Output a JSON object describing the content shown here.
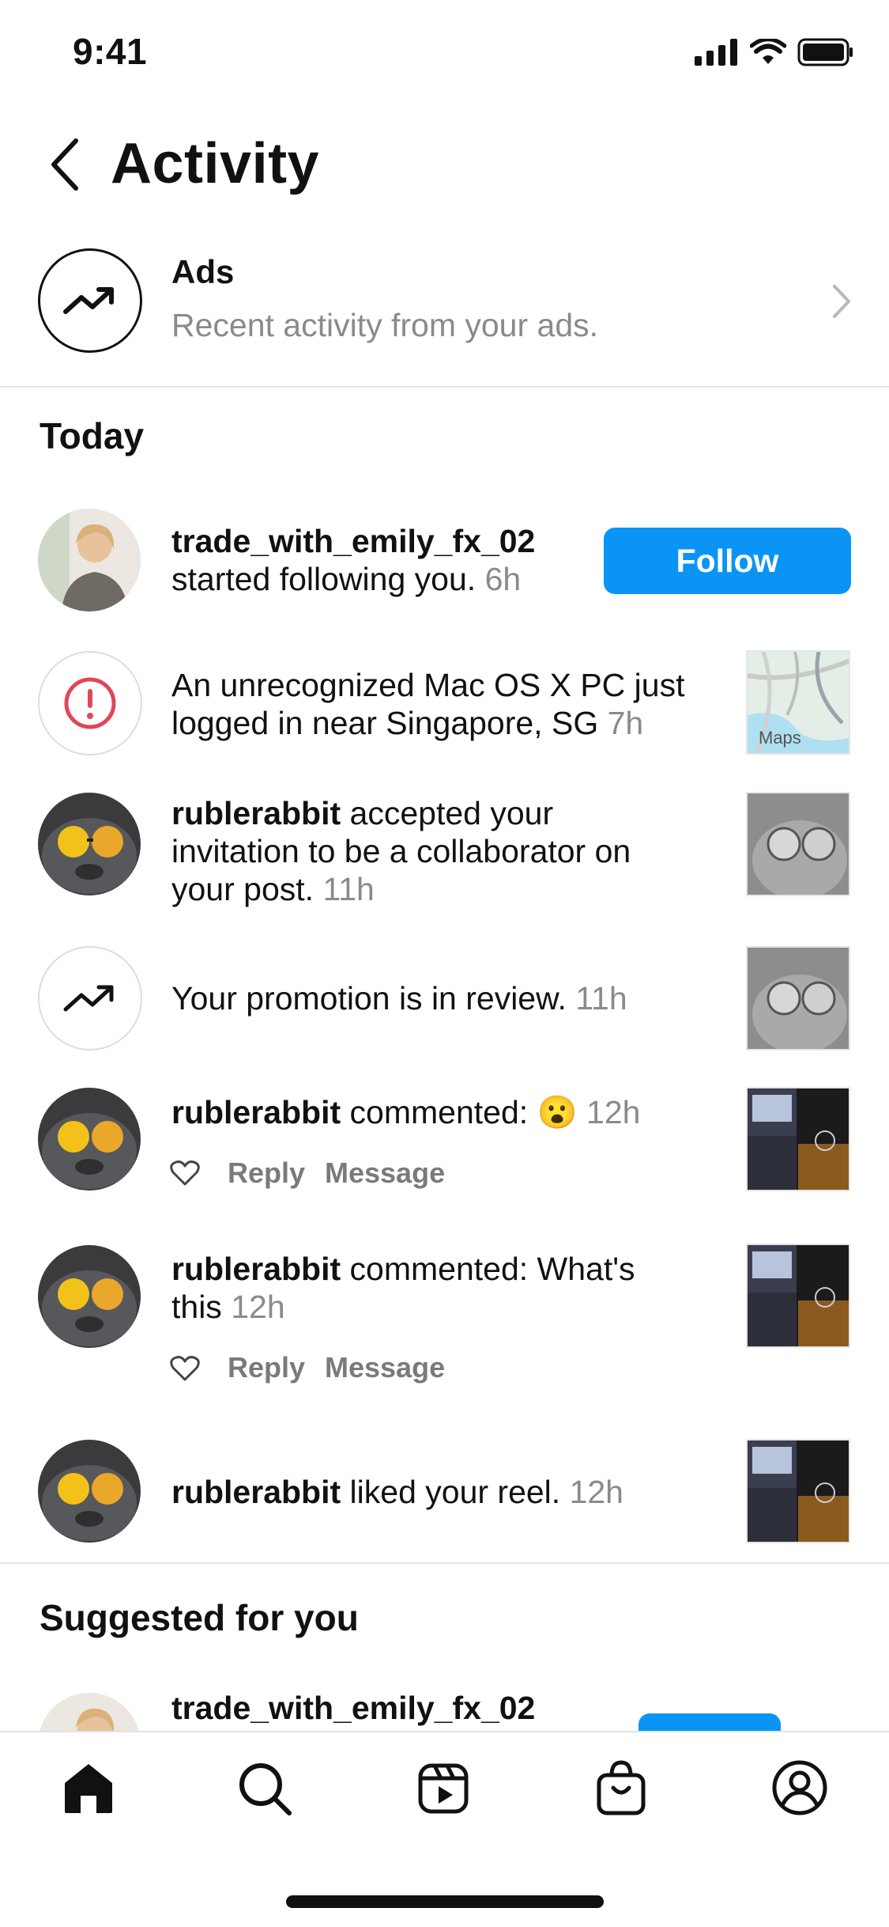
{
  "status_bar": {
    "time": "9:41"
  },
  "header": {
    "title": "Activity"
  },
  "ads": {
    "title": "Ads",
    "subtitle": "Recent activity from your ads."
  },
  "today": {
    "title": "Today",
    "items": [
      {
        "user": "trade_with_emily_fx_02",
        "text": "started following you.",
        "time": "6h",
        "button": "Follow"
      },
      {
        "text_line1": "An unrecognized Mac OS X PC just",
        "text_line2": "logged in near Singapore, SG",
        "time": "7h",
        "thumb_label": "Maps"
      },
      {
        "user": "rublerabbit",
        "text_line1": "accepted your",
        "text_line2": "invitation to be a collaborator on",
        "text_line3": "your post.",
        "time": "11h"
      },
      {
        "text": "Your promotion is in review.",
        "time": "11h"
      },
      {
        "user": "rublerabbit",
        "text": "commented:",
        "emoji": "😮",
        "time": "12h",
        "reply": "Reply",
        "message": "Message"
      },
      {
        "user": "rublerabbit",
        "text": "commented: What's",
        "text_line2": "this",
        "time": "12h",
        "reply": "Reply",
        "message": "Message"
      },
      {
        "user": "rublerabbit",
        "text": "liked your reel.",
        "time": "12h"
      }
    ]
  },
  "suggested": {
    "title": "Suggested for you",
    "user": "trade_with_emily_fx_02"
  },
  "tabbar": {
    "icons": [
      "home-icon",
      "search-icon",
      "reels-icon",
      "shop-icon",
      "profile-icon"
    ]
  },
  "colors": {
    "accent": "#0A95F6",
    "alert": "#E0465A",
    "muted": "#8A8A8A"
  }
}
